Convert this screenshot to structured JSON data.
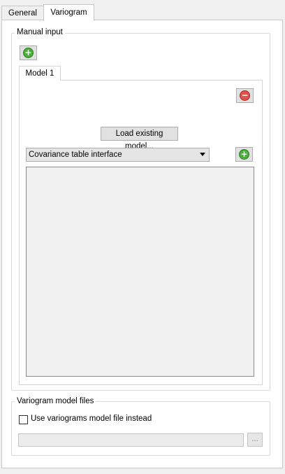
{
  "tabs": [
    {
      "label": "General",
      "active": false
    },
    {
      "label": "Variogram",
      "active": true
    }
  ],
  "manual_input": {
    "title": "Manual input",
    "add_model_icon": "plus-circle-green-icon",
    "model_tabs": [
      {
        "label": "Model 1",
        "active": true
      }
    ],
    "remove_model_icon": "minus-circle-red-icon",
    "load_button_label": "Load existing model...",
    "interface_select": {
      "selected": "Covariance table interface"
    },
    "add_structure_icon": "plus-circle-green-icon"
  },
  "variogram_files": {
    "title": "Variogram model files",
    "checkbox_label": "Use variograms model file instead",
    "checkbox_checked": false,
    "path_value": "",
    "browse_label": "..."
  },
  "colors": {
    "panel_bg": "#ffffff",
    "window_bg": "#f0f0f0",
    "add_green": "#4caf3a",
    "remove_red": "#e0524c"
  }
}
